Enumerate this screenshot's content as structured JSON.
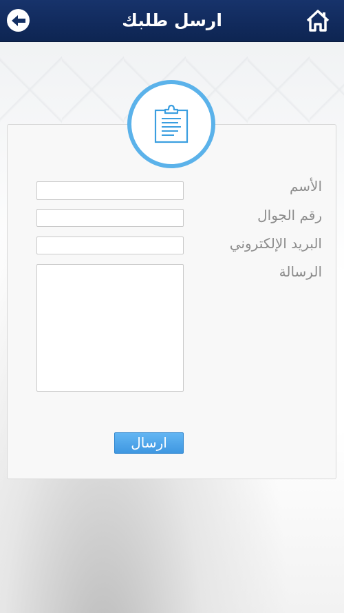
{
  "header": {
    "title": "ارسل طلبك",
    "back_icon": "arrow-left-icon",
    "home_icon": "home-icon"
  },
  "form": {
    "badge_icon": "clipboard-icon",
    "fields": [
      {
        "label": "الأسم",
        "value": ""
      },
      {
        "label": "رقم الجوال",
        "value": ""
      },
      {
        "label": "البريد الإلكتروني",
        "value": ""
      },
      {
        "label": "الرسالة",
        "value": ""
      }
    ],
    "submit_label": "ارسال"
  },
  "colors": {
    "header": "#122d60",
    "accent": "#5bb2ea",
    "button": "#4aa4ea"
  }
}
